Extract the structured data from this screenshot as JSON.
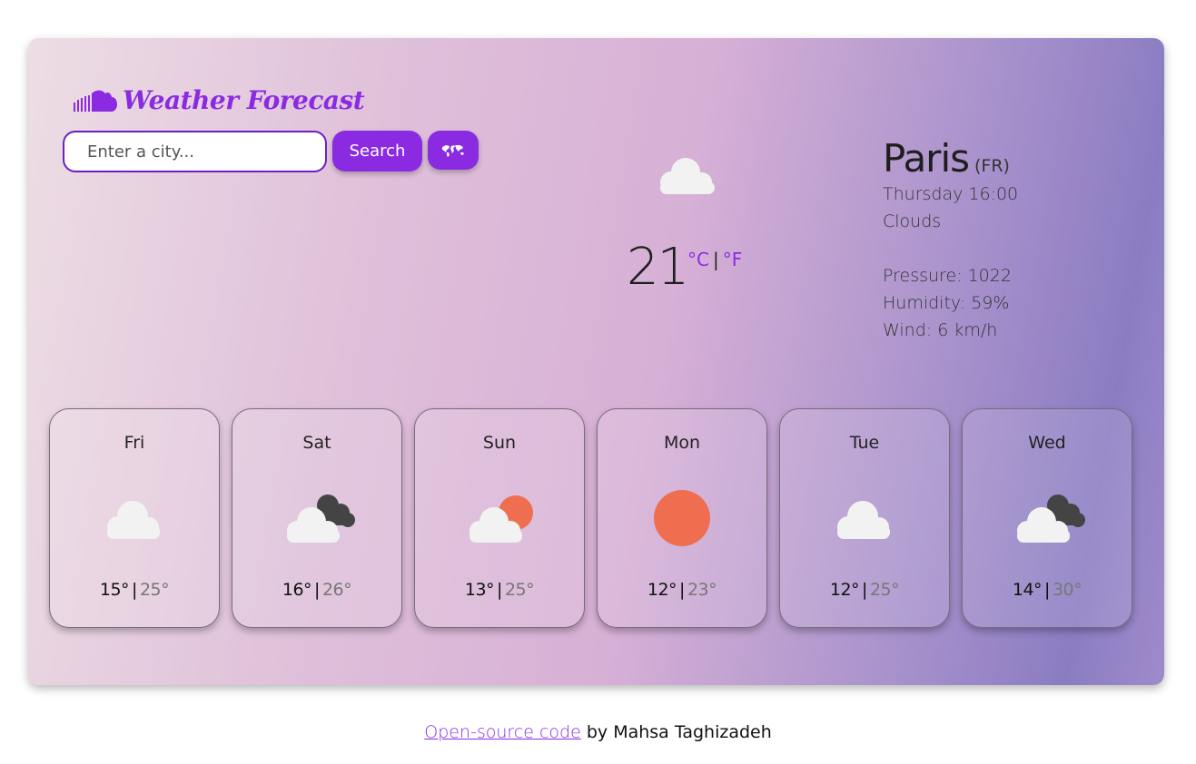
{
  "app": {
    "title": "Weather Forecast",
    "brand_icon": "cloud-icon"
  },
  "search": {
    "placeholder": "Enter a city...",
    "value": "",
    "button_label": "Search",
    "map_icon": "world-map-icon"
  },
  "colors": {
    "accent": "#8a2be2",
    "sun": "#ee6e4f",
    "cloud": "#f2f2f2",
    "dark_cloud": "#444444"
  },
  "current": {
    "icon": "cloud-icon",
    "temperature": "21",
    "unit_c": "°C",
    "unit_separator": "|",
    "unit_f": "°F",
    "city": "Paris",
    "country": "(FR)",
    "datetime": "Thursday 16:00",
    "description": "Clouds",
    "pressure": "Pressure: 1022",
    "humidity": "Humidity: 59%",
    "wind": "Wind: 6 km/h"
  },
  "forecast": [
    {
      "day": "Fri",
      "icon": "cloud-icon",
      "min": "15°",
      "sep": "|",
      "max": "25°"
    },
    {
      "day": "Sat",
      "icon": "dark-clouds-icon",
      "min": "16°",
      "sep": "|",
      "max": "26°"
    },
    {
      "day": "Sun",
      "icon": "sun-behind-cloud-icon",
      "min": "13°",
      "sep": "|",
      "max": "25°"
    },
    {
      "day": "Mon",
      "icon": "sun-icon",
      "min": "12°",
      "sep": "|",
      "max": "23°"
    },
    {
      "day": "Tue",
      "icon": "cloud-icon",
      "min": "12°",
      "sep": "|",
      "max": "25°"
    },
    {
      "day": "Wed",
      "icon": "dark-clouds-icon",
      "min": "14°",
      "sep": "|",
      "max": "30°"
    }
  ],
  "footer": {
    "link_text": "Open-source code",
    "rest": " by Mahsa Taghizadeh"
  }
}
